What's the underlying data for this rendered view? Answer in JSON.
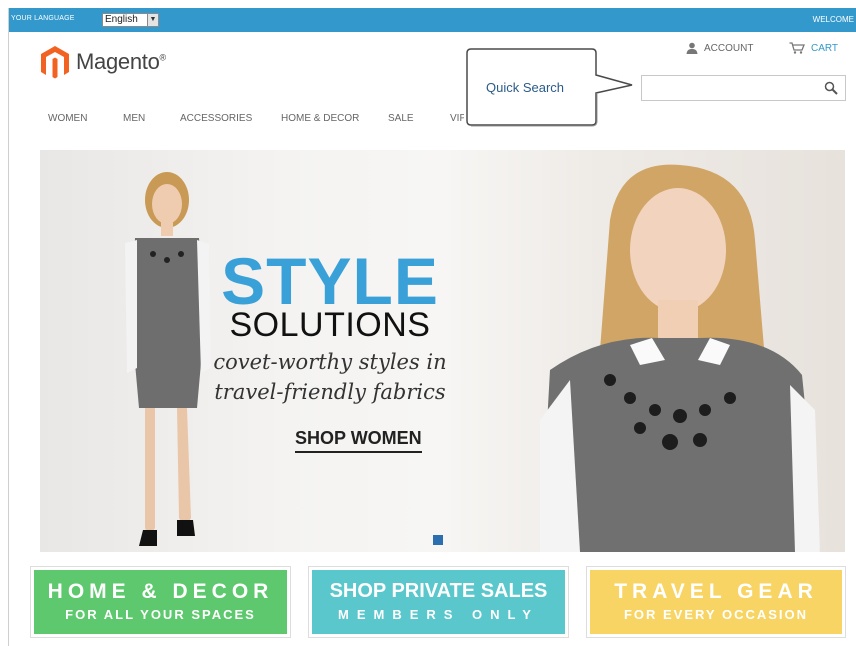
{
  "topbar": {
    "language_label": "YOUR LANGUAGE",
    "language_value": "English",
    "welcome": "WELCOME"
  },
  "logo": {
    "text": "Magento",
    "reg": "®"
  },
  "header": {
    "account": "ACCOUNT",
    "cart": "CART",
    "search_placeholder": ""
  },
  "callout": {
    "text": "Quick Search"
  },
  "nav": {
    "items": [
      "WOMEN",
      "MEN",
      "ACCESSORIES",
      "HOME & DECOR",
      "SALE",
      "VIP"
    ]
  },
  "hero": {
    "title": "STYLE",
    "subtitle": "SOLUTIONS",
    "tagline_1": "covet-worthy styles in",
    "tagline_2": "travel-friendly fabrics",
    "cta": "SHOP WOMEN"
  },
  "promos": [
    {
      "main": "HOME & DECOR",
      "sub": "FOR ALL YOUR SPACES"
    },
    {
      "main": "SHOP PRIVATE SALES",
      "sub": "MEMBERS ONLY"
    },
    {
      "main": "TRAVEL GEAR",
      "sub": "FOR EVERY OCCASION"
    }
  ],
  "colors": {
    "topbar": "#3399cc",
    "accent": "#39a0d8",
    "logo": "#f26322",
    "promo_green": "#5ec86e",
    "promo_teal": "#5ac7cc",
    "promo_yellow": "#f8d465"
  },
  "icons": {
    "logo": "magento-logo-icon",
    "account": "user-icon",
    "cart": "cart-icon",
    "search": "search-icon",
    "language": "chevron-down-icon"
  }
}
